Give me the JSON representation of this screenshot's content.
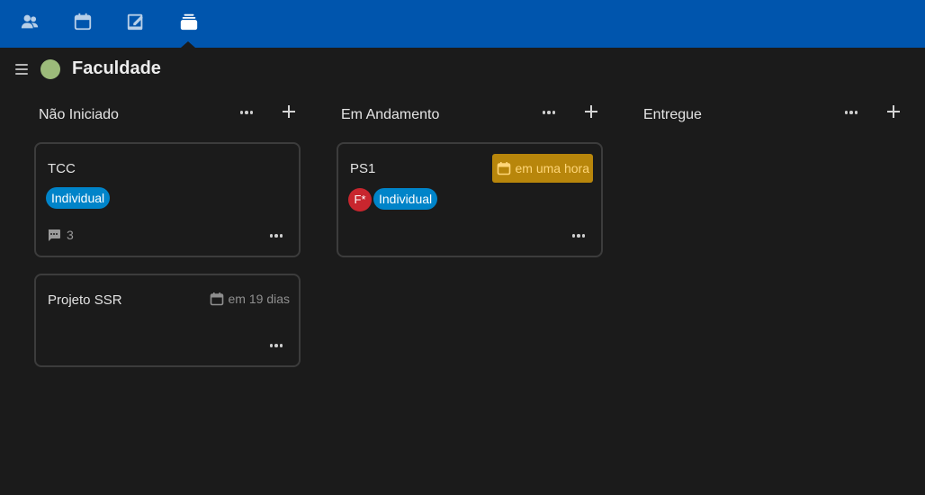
{
  "topbar": {
    "color": "#0055ad",
    "apps": [
      {
        "name": "contacts",
        "icon": "contacts-icon",
        "active": false
      },
      {
        "name": "calendar",
        "icon": "calendar-icon",
        "active": false
      },
      {
        "name": "notes",
        "icon": "notes-icon",
        "active": false
      },
      {
        "name": "deck",
        "icon": "deck-icon",
        "active": true
      }
    ]
  },
  "board": {
    "title": "Faculdade",
    "color": "#9cbb7a"
  },
  "stacks": [
    {
      "title": "Não Iniciado",
      "cards": [
        {
          "title": "TCC",
          "labels": [
            "Individual"
          ],
          "comments": "3"
        },
        {
          "title": "Projeto SSR",
          "due": "em 19 dias"
        }
      ]
    },
    {
      "title": "Em Andamento",
      "cards": [
        {
          "title": "PS1",
          "due": "em uma hora",
          "assignee": "F*",
          "labels": [
            "Individual"
          ]
        }
      ]
    },
    {
      "title": "Entregue",
      "cards": []
    }
  ],
  "colors": {
    "label": "#0084c9",
    "due_warning": "#b8860b",
    "avatar": "#c8262e"
  }
}
